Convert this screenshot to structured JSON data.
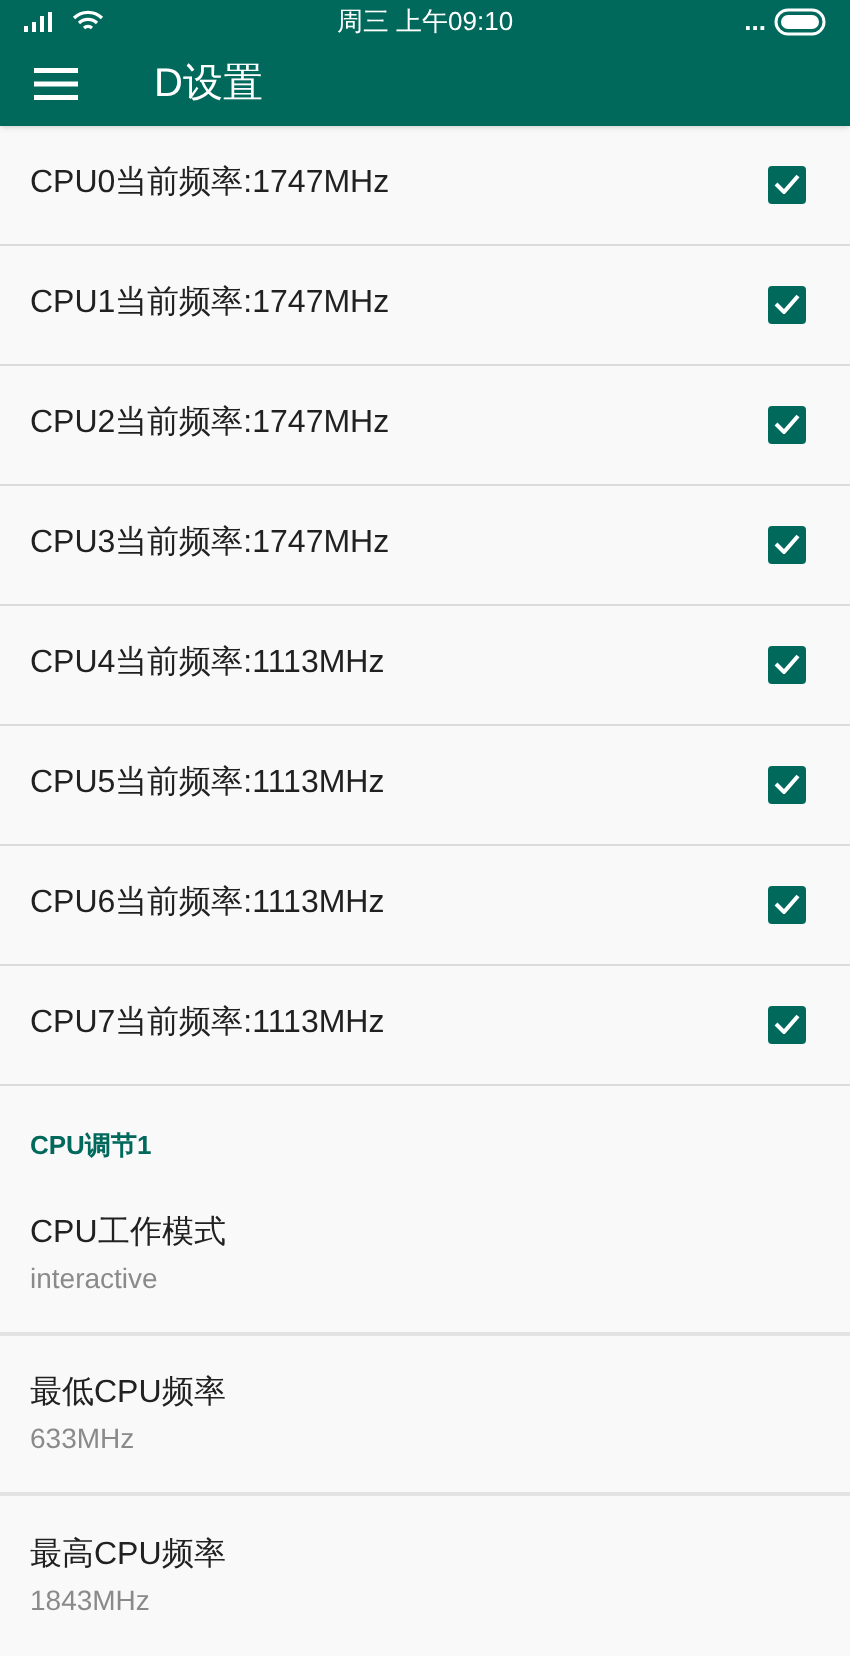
{
  "status_bar": {
    "time": "周三 上午09:10",
    "more": "..."
  },
  "toolbar": {
    "title": "D设置"
  },
  "cpu_items": [
    {
      "label": "CPU0当前频率:1747MHz",
      "checked": true
    },
    {
      "label": "CPU1当前频率:1747MHz",
      "checked": true
    },
    {
      "label": "CPU2当前频率:1747MHz",
      "checked": true
    },
    {
      "label": "CPU3当前频率:1747MHz",
      "checked": true
    },
    {
      "label": "CPU4当前频率:1113MHz",
      "checked": true
    },
    {
      "label": "CPU5当前频率:1113MHz",
      "checked": true
    },
    {
      "label": "CPU6当前频率:1113MHz",
      "checked": true
    },
    {
      "label": "CPU7当前频率:1113MHz",
      "checked": true
    }
  ],
  "section": {
    "title": "CPU调节1",
    "items": [
      {
        "title": "CPU工作模式",
        "summary": "interactive"
      },
      {
        "title": "最低CPU频率",
        "summary": "633MHz"
      },
      {
        "title": "最高CPU频率",
        "summary": "1843MHz"
      }
    ]
  }
}
